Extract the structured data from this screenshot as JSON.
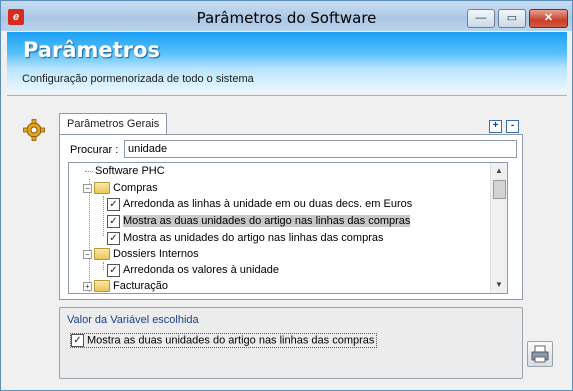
{
  "window": {
    "title": "Parâmetros do Software",
    "minimize": "—",
    "maximize": "▭",
    "close": "✕"
  },
  "banner": {
    "title": "Parâmetros",
    "subtitle": "Configuração pormenorizada de todo o sistema"
  },
  "tab": {
    "label": "Parâmetros Gerais",
    "plus": "+",
    "minus": "-"
  },
  "search": {
    "label": "Procurar :",
    "value": "unidade"
  },
  "tree": {
    "root": "Software PHC",
    "items": [
      {
        "kind": "folder",
        "label": "Compras"
      },
      {
        "kind": "check",
        "label": "Arredonda as linhas à unidade em  ou duas decs. em Euros",
        "checked": true
      },
      {
        "kind": "check",
        "label": "Mostra as duas unidades do artigo nas linhas das compras",
        "checked": true,
        "selected": true
      },
      {
        "kind": "check",
        "label": "Mostra as unidades do artigo nas linhas das compras",
        "checked": true
      },
      {
        "kind": "folder",
        "label": "Dossiers Internos"
      },
      {
        "kind": "check",
        "label": "Arredonda os valores à unidade",
        "checked": true
      },
      {
        "kind": "folder",
        "label": "Facturação"
      }
    ]
  },
  "value_panel": {
    "title": "Valor da Variável escolhida",
    "checkbox_label": "Mostra as duas unidades do artigo nas linhas das compras",
    "checked": true
  },
  "icons": {
    "gear": "gear-icon",
    "printer": "printer-icon"
  }
}
